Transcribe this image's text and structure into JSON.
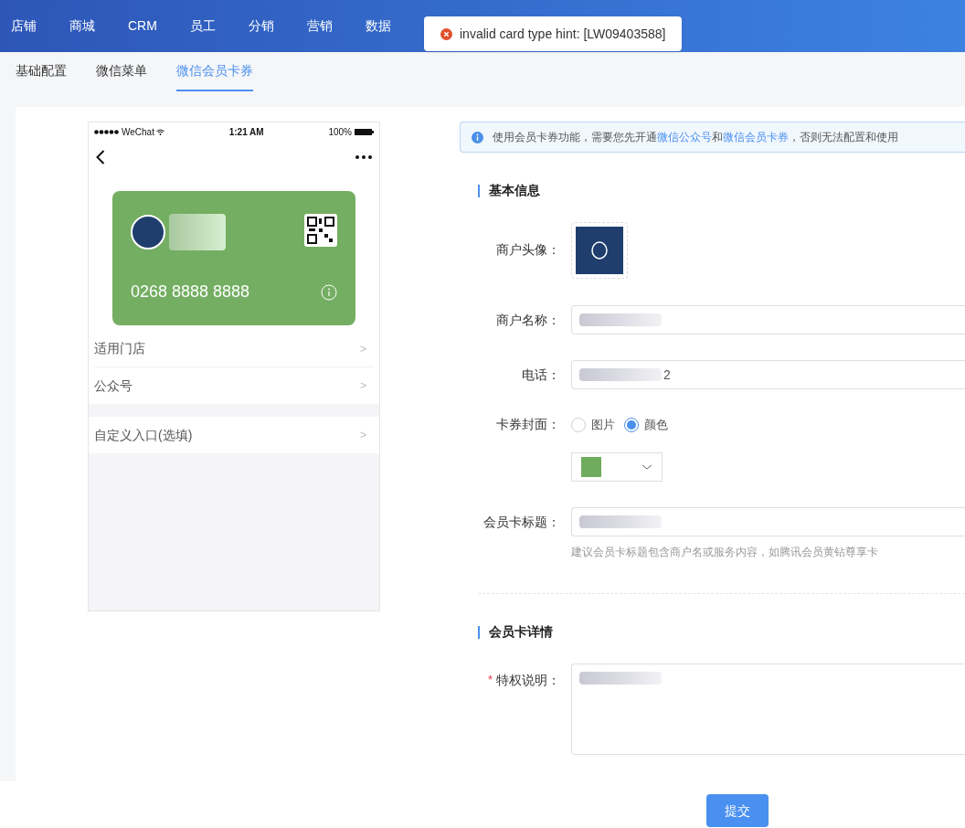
{
  "top_nav": [
    {
      "label": "店铺",
      "selected": false
    },
    {
      "label": "商城",
      "selected": false
    },
    {
      "label": "CRM",
      "selected": false
    },
    {
      "label": "员工",
      "selected": false
    },
    {
      "label": "分销",
      "selected": false
    },
    {
      "label": "营销",
      "selected": false
    },
    {
      "label": "数据",
      "selected": false
    }
  ],
  "toast": {
    "kind": "error",
    "message": "invalid card type hint: [LW09403588]"
  },
  "sub_tabs": [
    {
      "label": "基础配置",
      "selected": false
    },
    {
      "label": "微信菜单",
      "selected": false
    },
    {
      "label": "微信会员卡券",
      "selected": true
    }
  ],
  "phone_preview": {
    "status_bar": {
      "carrier": "WeChat",
      "time": "1:21 AM",
      "battery": "100%"
    },
    "card": {
      "color": "#74ae62",
      "number": "0268 8888 8888"
    },
    "menu_groups": [
      [
        {
          "label": "适用门店",
          "arrow": ">"
        },
        {
          "label": "公众号",
          "arrow": ">"
        }
      ],
      [
        {
          "label": "自定义入口(选填)",
          "arrow": ">"
        }
      ]
    ]
  },
  "notice": {
    "before": "使用会员卡券功能，需要您先开通",
    "link_1": "微信公众号",
    "middle": "和",
    "link_2": "微信会员卡券",
    "after": "，否则无法配置和使用"
  },
  "basic_info": {
    "title": "基本信息",
    "fields": [
      {
        "kind": "image",
        "label": "商户头像："
      },
      {
        "kind": "text",
        "label": "商户名称："
      },
      {
        "kind": "text",
        "label": "电话：",
        "value": "2"
      },
      {
        "kind": "radio",
        "label": "卡券封面：",
        "options": [
          {
            "label": "图片",
            "selected": false
          },
          {
            "label": "颜色",
            "selected": true
          }
        ]
      },
      {
        "kind": "color",
        "color": "#6fac5e"
      },
      {
        "kind": "text",
        "label": "会员卡标题：",
        "hint": "建议会员卡标题包含商户名或服务内容，如腾讯会员黄钻尊享卡"
      }
    ]
  },
  "details": {
    "title": "会员卡详情",
    "fields": [
      {
        "kind": "textarea",
        "label": "特权说明：",
        "required_mark": "*"
      }
    ]
  },
  "submit": "提交"
}
